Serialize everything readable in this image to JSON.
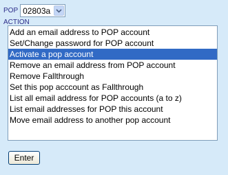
{
  "pop": {
    "label": "POP",
    "selected_value": "02803a",
    "icon": "chevron-down-icon"
  },
  "action": {
    "label": "ACTION",
    "options": [
      "Add an email address to POP account",
      "Set/Change password for POP account",
      "Activate a pop account",
      "Remove an email address from POP account",
      "Remove Fallthrough",
      "Set this pop acccount as Fallthrough",
      "List all email address for POP accounts (a to z)",
      "List email addresses for POP this account",
      "Move email address to another pop account"
    ],
    "selected_index": 2
  },
  "buttons": {
    "enter_label": "Enter"
  },
  "colors": {
    "page_background": "#d6eaf9",
    "label_text": "#2b2b88",
    "selection_background": "#316ac5",
    "field_border": "#7f9db9"
  }
}
